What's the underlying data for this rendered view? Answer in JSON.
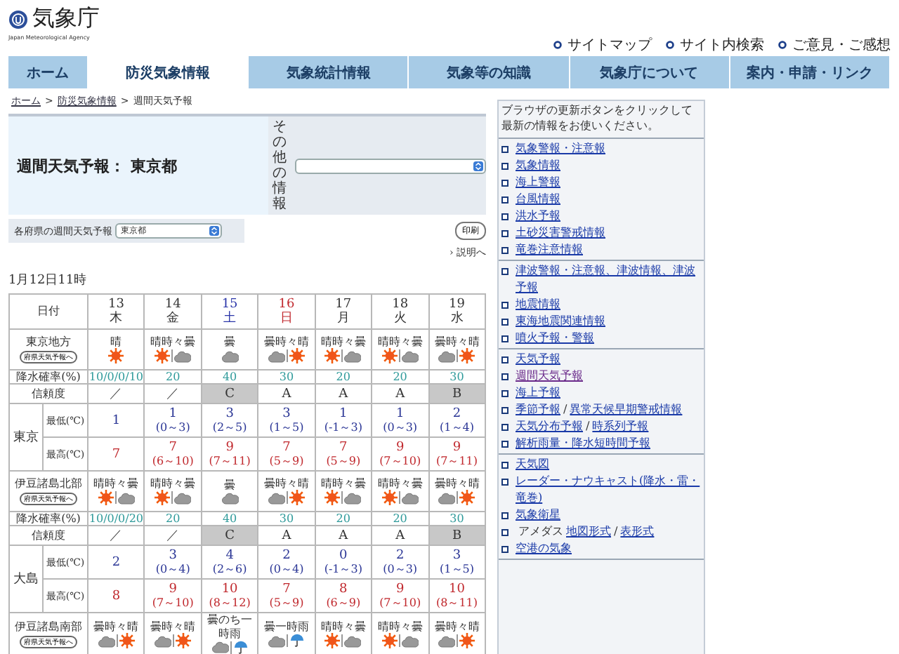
{
  "header": {
    "logo_text": "気象庁",
    "logo_subtext": "Japan Meteorological Agency",
    "links": [
      "サイトマップ",
      "サイト内検索",
      "ご意見・ご感想"
    ]
  },
  "nav": [
    {
      "label": "ホーム",
      "selected": false
    },
    {
      "label": "防災気象情報",
      "selected": true
    },
    {
      "label": "気象統計情報",
      "selected": false
    },
    {
      "label": "気象等の知識",
      "selected": false
    },
    {
      "label": "気象庁について",
      "selected": false
    },
    {
      "label": "案内・申請・リンク",
      "selected": false
    }
  ],
  "breadcrumb": {
    "links": [
      "ホーム",
      "防災気象情報"
    ],
    "current": "週間天気予報",
    "separator": ">"
  },
  "title": "週間天気予報： 東京都",
  "other_info": {
    "label": "その他の情報"
  },
  "prefecture": {
    "label": "各府県の週間天気予報",
    "value": "東京都"
  },
  "print_button": "印刷",
  "explain_link": "› 説明へ",
  "issued": "1月12日11時",
  "table": {
    "date_header": "日付",
    "days": [
      {
        "date": "13",
        "weekday": "木",
        "kind": "weekday"
      },
      {
        "date": "14",
        "weekday": "金",
        "kind": "weekday"
      },
      {
        "date": "15",
        "weekday": "土",
        "kind": "saturday"
      },
      {
        "date": "16",
        "weekday": "日",
        "kind": "sunday"
      },
      {
        "date": "17",
        "weekday": "月",
        "kind": "weekday"
      },
      {
        "date": "18",
        "weekday": "火",
        "kind": "weekday"
      },
      {
        "date": "19",
        "weekday": "水",
        "kind": "weekday"
      }
    ],
    "regions": [
      {
        "name": "東京地方",
        "button": "府県天気予報へ",
        "rain_label": "降水確率(%)",
        "reliability_label": "信頼度",
        "min_label": "最低(℃)",
        "max_label": "最高(℃)",
        "forecasts": [
          {
            "text": "晴",
            "icons": [
              {
                "kind": "sun"
              }
            ]
          },
          {
            "text": "晴時々曇",
            "icons": [
              {
                "kind": "sun"
              },
              {
                "kind": "cloud"
              }
            ]
          },
          {
            "text": "曇",
            "icons": [
              {
                "kind": "cloud"
              }
            ]
          },
          {
            "text": "曇時々晴",
            "icons": [
              {
                "kind": "cloud"
              },
              {
                "kind": "sun"
              }
            ]
          },
          {
            "text": "晴時々曇",
            "icons": [
              {
                "kind": "sun"
              },
              {
                "kind": "cloud"
              }
            ]
          },
          {
            "text": "晴時々曇",
            "icons": [
              {
                "kind": "sun"
              },
              {
                "kind": "cloud"
              }
            ]
          },
          {
            "text": "曇時々晴",
            "icons": [
              {
                "kind": "cloud"
              },
              {
                "kind": "sun"
              }
            ]
          }
        ],
        "rain": [
          "10/0/0/10",
          "20",
          "40",
          "30",
          "20",
          "20",
          "30"
        ],
        "reliability": [
          {
            "text": "／",
            "shaded": false
          },
          {
            "text": "／",
            "shaded": false
          },
          {
            "text": "C",
            "shaded": true
          },
          {
            "text": "A",
            "shaded": false
          },
          {
            "text": "A",
            "shaded": false
          },
          {
            "text": "A",
            "shaded": false
          },
          {
            "text": "B",
            "shaded": true
          }
        ],
        "city": "東京",
        "min": [
          {
            "value": "1"
          },
          {
            "value": "1",
            "range": "(0～3)"
          },
          {
            "value": "3",
            "range": "(2～5)"
          },
          {
            "value": "3",
            "range": "(1～5)"
          },
          {
            "value": "1",
            "range": "(-1～3)"
          },
          {
            "value": "1",
            "range": "(0～3)"
          },
          {
            "value": "2",
            "range": "(1～4)"
          }
        ],
        "max": [
          {
            "value": "7"
          },
          {
            "value": "7",
            "range": "(6～10)"
          },
          {
            "value": "9",
            "range": "(7～11)"
          },
          {
            "value": "7",
            "range": "(5～9)"
          },
          {
            "value": "7",
            "range": "(5～9)"
          },
          {
            "value": "9",
            "range": "(7～10)"
          },
          {
            "value": "9",
            "range": "(7～11)"
          }
        ]
      },
      {
        "name": "伊豆諸島北部",
        "button": "府県天気予報へ",
        "rain_label": "降水確率(%)",
        "reliability_label": "信頼度",
        "min_label": "最低(℃)",
        "max_label": "最高(℃)",
        "forecasts": [
          {
            "text": "晴時々曇",
            "icons": [
              {
                "kind": "sun"
              },
              {
                "kind": "cloud"
              }
            ]
          },
          {
            "text": "晴時々曇",
            "icons": [
              {
                "kind": "sun"
              },
              {
                "kind": "cloud"
              }
            ]
          },
          {
            "text": "曇",
            "icons": [
              {
                "kind": "cloud"
              }
            ]
          },
          {
            "text": "曇時々晴",
            "icons": [
              {
                "kind": "cloud"
              },
              {
                "kind": "sun"
              }
            ]
          },
          {
            "text": "晴時々曇",
            "icons": [
              {
                "kind": "sun"
              },
              {
                "kind": "cloud"
              }
            ]
          },
          {
            "text": "晴時々曇",
            "icons": [
              {
                "kind": "sun"
              },
              {
                "kind": "cloud"
              }
            ]
          },
          {
            "text": "曇時々晴",
            "icons": [
              {
                "kind": "cloud"
              },
              {
                "kind": "sun"
              }
            ]
          }
        ],
        "rain": [
          "10/0/0/20",
          "20",
          "40",
          "30",
          "20",
          "20",
          "30"
        ],
        "reliability": [
          {
            "text": "／",
            "shaded": false
          },
          {
            "text": "／",
            "shaded": false
          },
          {
            "text": "C",
            "shaded": true
          },
          {
            "text": "A",
            "shaded": false
          },
          {
            "text": "A",
            "shaded": false
          },
          {
            "text": "A",
            "shaded": false
          },
          {
            "text": "B",
            "shaded": true
          }
        ],
        "city": "大島",
        "min": [
          {
            "value": "2"
          },
          {
            "value": "3",
            "range": "(0～4)"
          },
          {
            "value": "4",
            "range": "(2～6)"
          },
          {
            "value": "2",
            "range": "(0～4)"
          },
          {
            "value": "0",
            "range": "(-1～3)"
          },
          {
            "value": "2",
            "range": "(0～3)"
          },
          {
            "value": "3",
            "range": "(1～5)"
          }
        ],
        "max": [
          {
            "value": "8"
          },
          {
            "value": "9",
            "range": "(7～10)"
          },
          {
            "value": "10",
            "range": "(8～12)"
          },
          {
            "value": "7",
            "range": "(5～9)"
          },
          {
            "value": "8",
            "range": "(6～9)"
          },
          {
            "value": "9",
            "range": "(7～10)"
          },
          {
            "value": "10",
            "range": "(8～11)"
          }
        ]
      },
      {
        "name": "伊豆諸島南部",
        "button": "府県天気予報へ",
        "forecasts": [
          {
            "text": "曇時々晴",
            "icons": [
              {
                "kind": "cloud"
              },
              {
                "kind": "sun"
              }
            ]
          },
          {
            "text": "曇時々晴",
            "icons": [
              {
                "kind": "cloud"
              },
              {
                "kind": "sun"
              }
            ]
          },
          {
            "text": "曇のち一時雨",
            "icons": [
              {
                "kind": "cloud"
              },
              {
                "kind": "rain"
              }
            ]
          },
          {
            "text": "曇一時雨",
            "icons": [
              {
                "kind": "cloud"
              },
              {
                "kind": "rain"
              }
            ]
          },
          {
            "text": "晴時々曇",
            "icons": [
              {
                "kind": "sun"
              },
              {
                "kind": "cloud"
              }
            ]
          },
          {
            "text": "晴時々曇",
            "icons": [
              {
                "kind": "sun"
              },
              {
                "kind": "cloud"
              }
            ]
          },
          {
            "text": "曇時々晴",
            "icons": [
              {
                "kind": "cloud"
              },
              {
                "kind": "sun"
              }
            ]
          }
        ]
      }
    ]
  },
  "sidebar": {
    "notice": "ブラウザの更新ボタンをクリックして最新の情報をお使いください。",
    "groups": [
      [
        {
          "parts": [
            {
              "kind": "link",
              "text": "気象警報・注意報"
            }
          ]
        },
        {
          "parts": [
            {
              "kind": "link",
              "text": "気象情報"
            }
          ]
        },
        {
          "parts": [
            {
              "kind": "link",
              "text": "海上警報"
            }
          ]
        },
        {
          "parts": [
            {
              "kind": "link",
              "text": "台風情報"
            }
          ]
        },
        {
          "parts": [
            {
              "kind": "link",
              "text": "洪水予報"
            }
          ]
        },
        {
          "parts": [
            {
              "kind": "link",
              "text": "土砂災害警戒情報"
            }
          ]
        },
        {
          "parts": [
            {
              "kind": "link",
              "text": "竜巻注意情報"
            }
          ]
        }
      ],
      [
        {
          "parts": [
            {
              "kind": "link",
              "text": "津波警報・注意報、津波情報、津波予報"
            }
          ]
        },
        {
          "parts": [
            {
              "kind": "link",
              "text": "地震情報"
            }
          ]
        },
        {
          "parts": [
            {
              "kind": "link",
              "text": "東海地震関連情報"
            }
          ]
        },
        {
          "parts": [
            {
              "kind": "link",
              "text": "噴火予報・警報"
            }
          ]
        }
      ],
      [
        {
          "parts": [
            {
              "kind": "link",
              "text": "天気予報"
            }
          ]
        },
        {
          "parts": [
            {
              "kind": "visited",
              "text": "週間天気予報"
            }
          ]
        },
        {
          "parts": [
            {
              "kind": "link",
              "text": "海上予報"
            }
          ]
        },
        {
          "parts": [
            {
              "kind": "link",
              "text": "季節予報"
            },
            {
              "kind": "text",
              "text": "/"
            },
            {
              "kind": "link",
              "text": "異常天候早期警戒情報"
            }
          ]
        },
        {
          "parts": [
            {
              "kind": "link",
              "text": "天気分布予報"
            },
            {
              "kind": "text",
              "text": "/"
            },
            {
              "kind": "link",
              "text": "時系列予報"
            }
          ]
        },
        {
          "parts": [
            {
              "kind": "link",
              "text": "解析雨量・降水短時間予報"
            }
          ]
        }
      ],
      [
        {
          "parts": [
            {
              "kind": "link",
              "text": "天気図"
            }
          ]
        },
        {
          "parts": [
            {
              "kind": "link",
              "text": "レーダー・ナウキャスト(降水・雷・竜巻)"
            }
          ]
        },
        {
          "parts": [
            {
              "kind": "link",
              "text": "気象衛星"
            }
          ]
        },
        {
          "parts": [
            {
              "kind": "text",
              "text": "アメダス"
            },
            {
              "kind": "link",
              "text": "地図形式"
            },
            {
              "kind": "text",
              "text": "/"
            },
            {
              "kind": "link",
              "text": "表形式"
            }
          ]
        },
        {
          "parts": [
            {
              "kind": "link",
              "text": "空港の気象"
            }
          ]
        }
      ]
    ]
  }
}
